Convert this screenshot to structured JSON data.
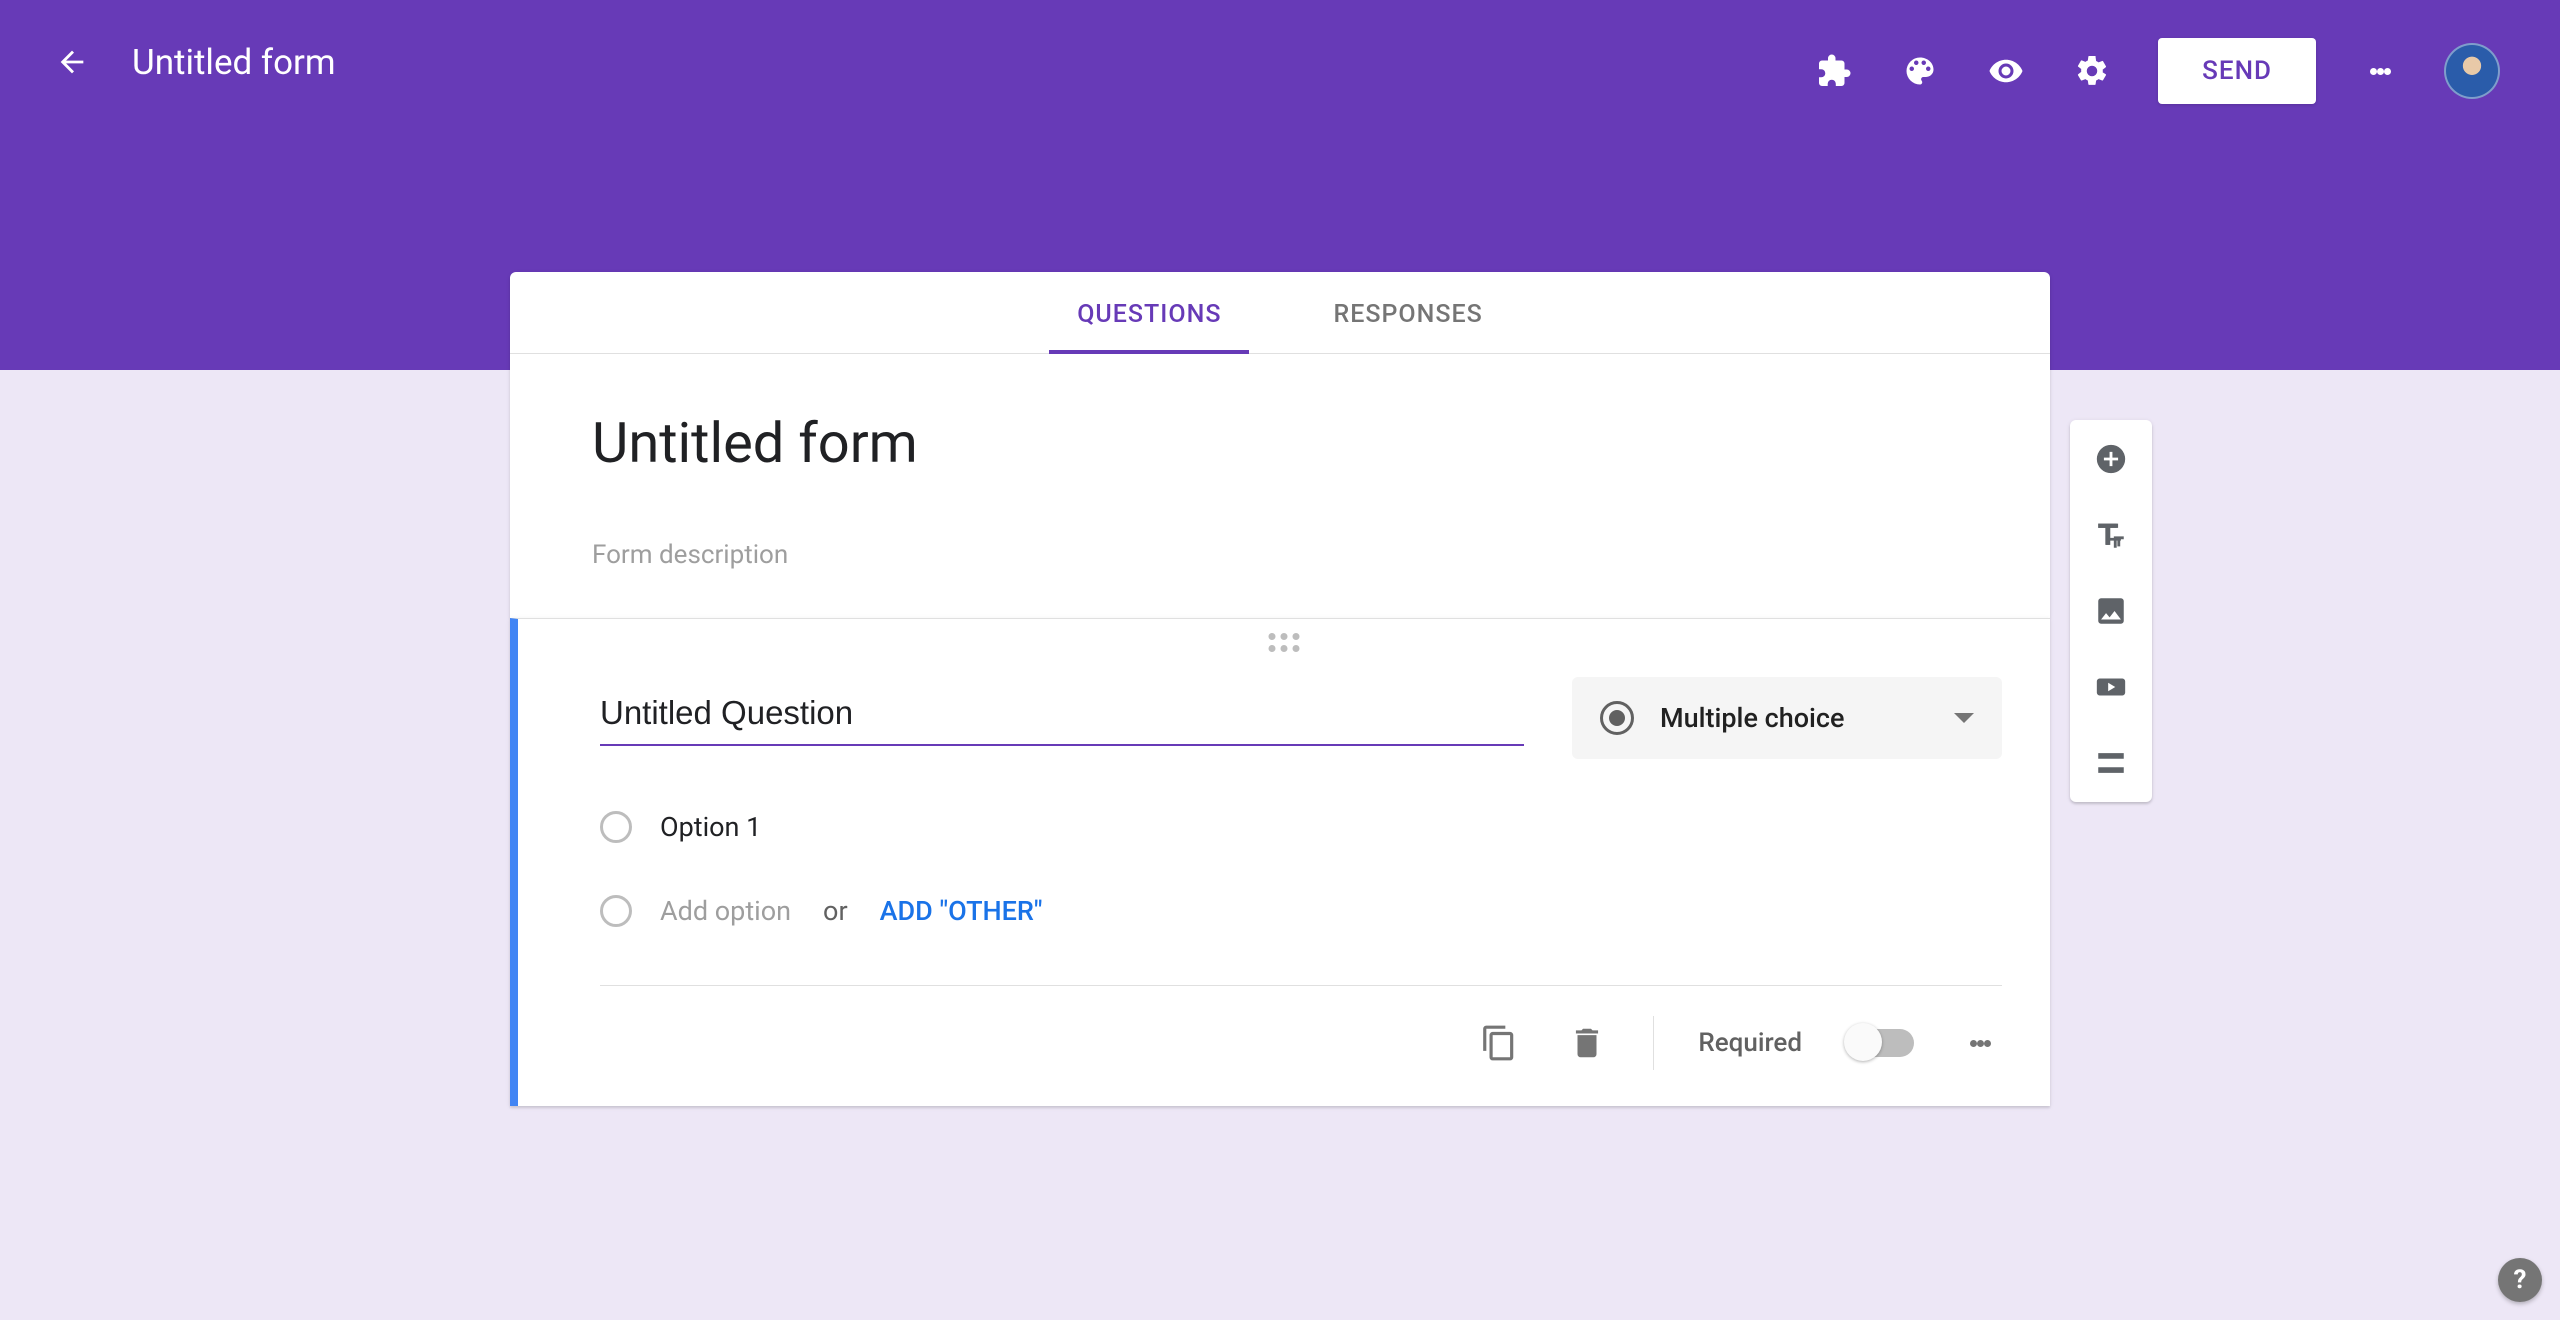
{
  "colors": {
    "primary": "#673ab7",
    "accent": "#4285f4",
    "background": "#ede7f6"
  },
  "header": {
    "doc_title": "Untitled form",
    "send_label": "SEND"
  },
  "tabs": {
    "questions": "QUESTIONS",
    "responses": "RESPONSES",
    "active": "questions"
  },
  "form": {
    "title": "Untitled form",
    "description_placeholder": "Form description"
  },
  "question": {
    "title": "Untitled Question",
    "type_label": "Multiple choice",
    "options": [
      {
        "label": "Option 1"
      }
    ],
    "add_option_placeholder": "Add option",
    "or_text": "or",
    "add_other_label": "ADD \"OTHER\"",
    "required_label": "Required",
    "required_value": false
  },
  "side_toolbar": {
    "add_question": "add-question",
    "add_title": "add-title-description",
    "add_image": "add-image",
    "add_video": "add-video",
    "add_section": "add-section"
  },
  "help_label": "?"
}
